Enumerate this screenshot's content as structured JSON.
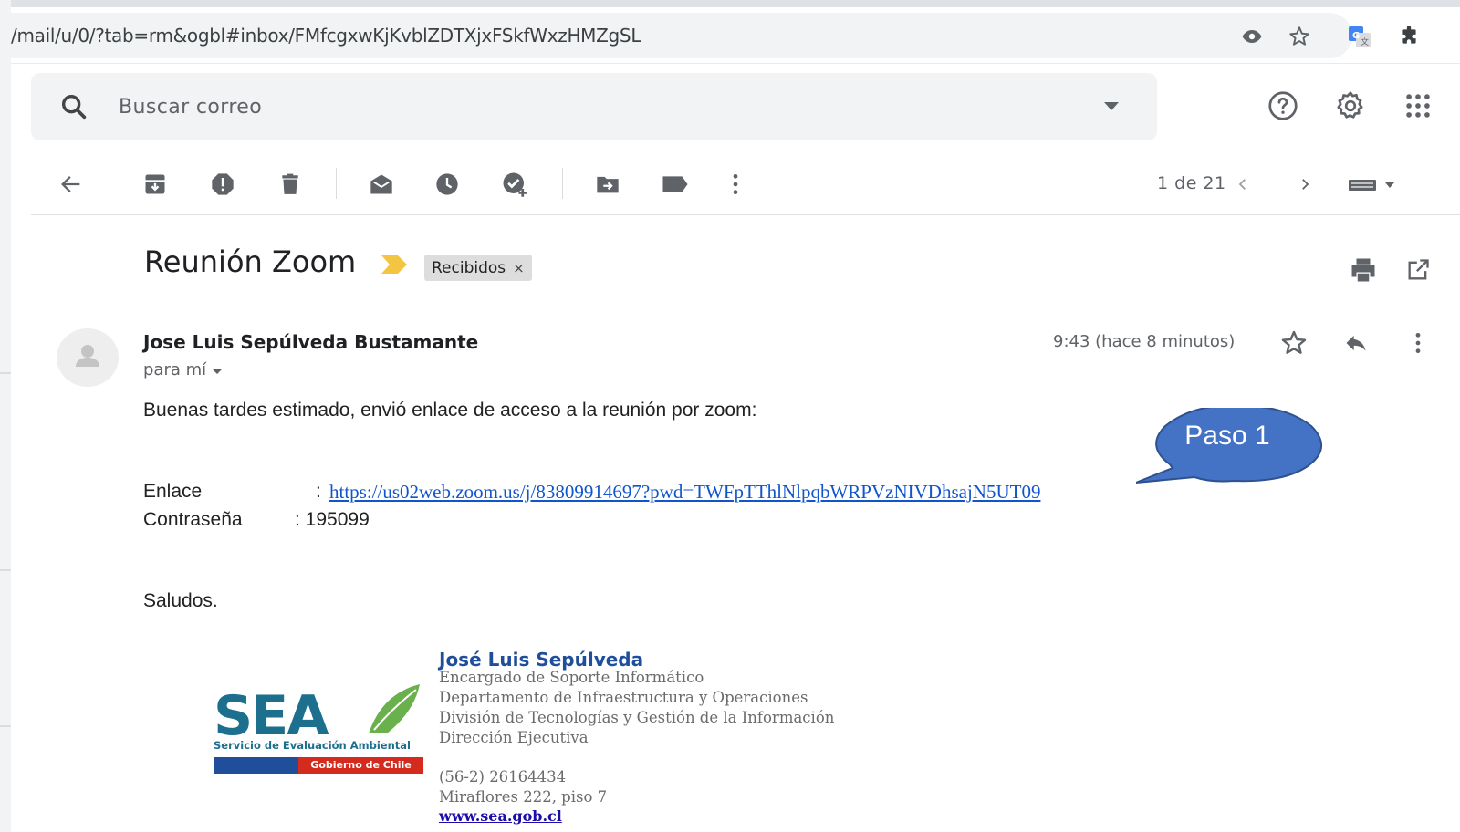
{
  "browser": {
    "url": "/mail/u/0/?tab=rm&ogbl#inbox/FMfcgxwKjKvblZDTXjxFSkfWxzHMZgSL"
  },
  "search": {
    "placeholder": "Buscar correo"
  },
  "toolbar": {
    "pager": "1 de 21"
  },
  "message": {
    "subject": "Reunión Zoom",
    "label": "Recibidos",
    "label_close": "×",
    "sender": "Jose Luis Sepúlveda Bustamante",
    "to": "para mí",
    "time": "9:43 (hace 8 minutos)",
    "greeting": "Buenas tardes estimado, envió enlace de acceso a la reunión por zoom:",
    "link_label": "Enlace",
    "link_sep": ":",
    "link_url": "https://us02web.zoom.us/j/83809914697?pwd=TWFpTThlNlpqbWRPVzNIVDhsajN5UT09",
    "password_label": "Contraseña",
    "password_value": ": 195099",
    "closing": "Saludos."
  },
  "callout": {
    "text": "Paso 1"
  },
  "signature": {
    "name": "José Luis Sepúlveda",
    "role": "Encargado de Soporte Informático",
    "department": "Departamento de Infraestructura y Operaciones",
    "division": "División de Tecnologías y Gestión de la Información",
    "office": "Dirección Ejecutiva",
    "phone": "(56-2) 26164434",
    "address": "Miraflores 222, piso 7",
    "website": "www.sea.gob.cl",
    "logo_caption": "Servicio de Evaluación Ambiental",
    "logo_gov": "Gobierno de Chile"
  },
  "colors": {
    "link": "#1155cc",
    "callout_fill": "#4472c4",
    "important": "#f4c542",
    "sig_name": "#1f4e9a"
  }
}
